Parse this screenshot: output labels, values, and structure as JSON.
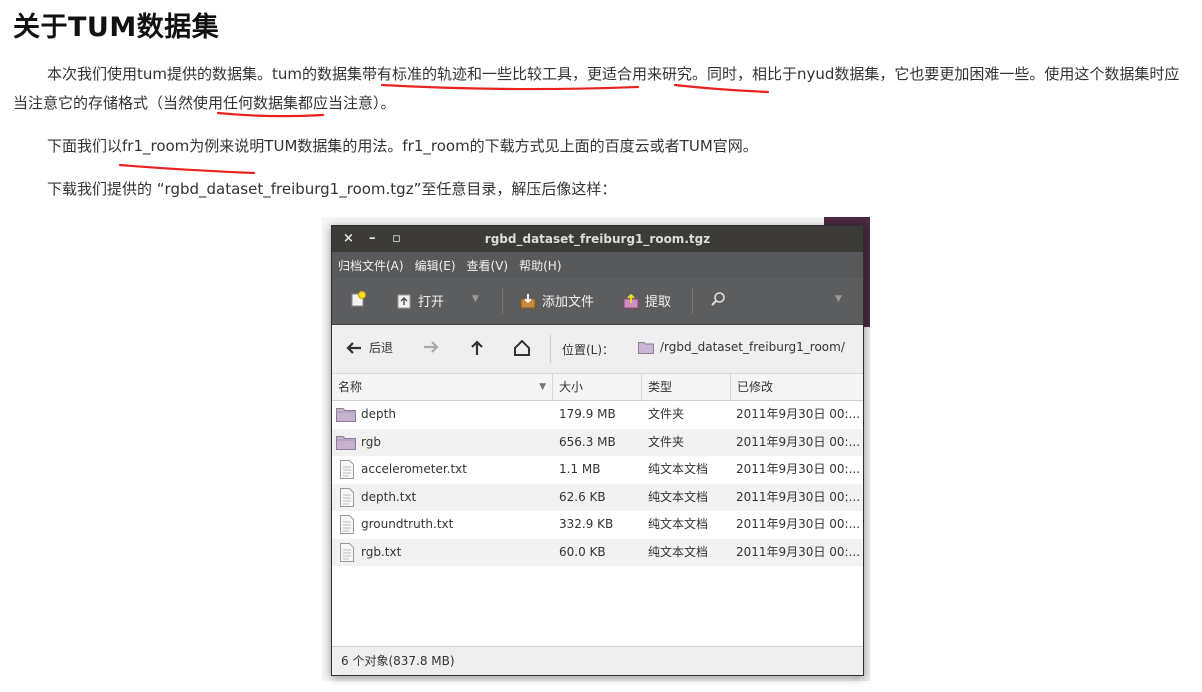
{
  "heading": "关于TUM数据集",
  "paragraphs": [
    "本次我们使用tum提供的数据集。tum的数据集带有标准的轨迹和一些比较工具，更适合用来研究。同时，相比于nyud数据集，它也要更加困难一些。使用这个数据集时应当注意它的存储格式（当然使用任何数据集都应当注意）。",
    "下面我们以fr1_room为例来说明TUM数据集的用法。fr1_room的下载方式见上面的百度云或者TUM官网。",
    "下载我们提供的 “rgbd_dataset_freiburg1_room.tgz”至任意目录，解压后像这样："
  ],
  "window": {
    "title": "rgbd_dataset_freiburg1_room.tgz",
    "controls": {
      "close": "×",
      "minimize": "–",
      "maximize": "▫"
    },
    "menu": [
      "归档文件(A)",
      "编辑(E)",
      "查看(V)",
      "帮助(H)"
    ],
    "toolbar": {
      "open": "打开",
      "add_files": "添加文件",
      "extract": "提取"
    },
    "nav": {
      "back": "后退",
      "location_label": "位置(L)：",
      "location_path": "/rgbd_dataset_freiburg1_room/"
    },
    "columns": {
      "name": "名称",
      "size": "大小",
      "type": "类型",
      "modified": "已修改"
    },
    "files": [
      {
        "name": "depth",
        "size": "179.9 MB",
        "type": "文件夹",
        "modified": "2011年9月30日 00:...",
        "icon": "folder-icon"
      },
      {
        "name": "rgb",
        "size": "656.3 MB",
        "type": "文件夹",
        "modified": "2011年9月30日 00:...",
        "icon": "folder-icon"
      },
      {
        "name": "accelerometer.txt",
        "size": "1.1 MB",
        "type": "纯文本文档",
        "modified": "2011年9月30日 00:...",
        "icon": "text-file-icon"
      },
      {
        "name": "depth.txt",
        "size": "62.6 KB",
        "type": "纯文本文档",
        "modified": "2011年9月30日 00:...",
        "icon": "text-file-icon"
      },
      {
        "name": "groundtruth.txt",
        "size": "332.9 KB",
        "type": "纯文本文档",
        "modified": "2011年9月30日 00:...",
        "icon": "text-file-icon"
      },
      {
        "name": "rgb.txt",
        "size": "60.0 KB",
        "type": "纯文本文档",
        "modified": "2011年9月30日 00:...",
        "icon": "text-file-icon"
      }
    ],
    "status": "6 个对象(837.8 MB)"
  },
  "colors": {
    "underline": "#e8231f",
    "titlebar": "#3c3b37",
    "toolbar": "#5c5d5f",
    "folder": "#b8a6c2"
  }
}
